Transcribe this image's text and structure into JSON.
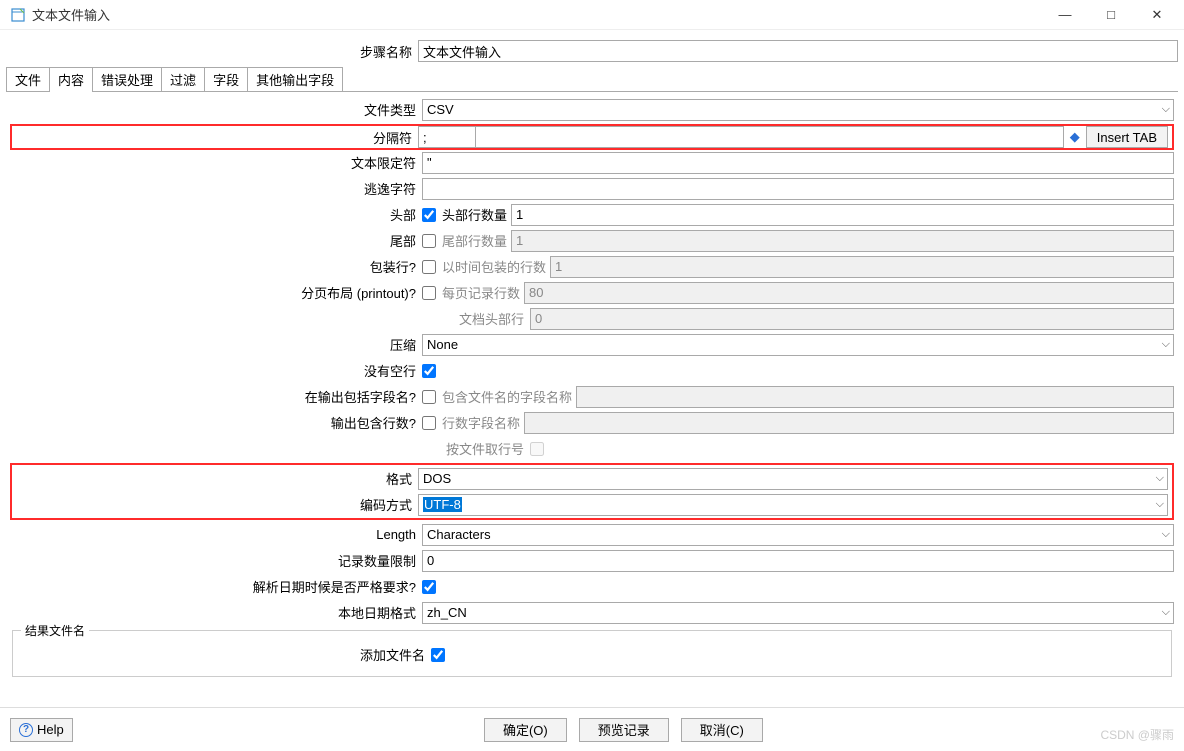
{
  "window": {
    "title": "文本文件输入",
    "min": "—",
    "max": "□",
    "close": "✕"
  },
  "step": {
    "label": "步骤名称",
    "value": "文本文件输入"
  },
  "tabs": [
    "文件",
    "内容",
    "错误处理",
    "过滤",
    "字段",
    "其他输出字段"
  ],
  "labels": {
    "filetype": "文件类型",
    "separator": "分隔符",
    "enclosure": "文本限定符",
    "escape": "逃逸字符",
    "header": "头部",
    "header_rows": "头部行数量",
    "footer": "尾部",
    "footer_rows": "尾部行数量",
    "wrap": "包装行?",
    "wrap_rows": "以时间包装的行数",
    "paged": "分页布局 (printout)?",
    "paged_rows": "每页记录行数",
    "doc_header": "文档头部行",
    "compress": "压缩",
    "no_empty": "没有空行",
    "inc_filename": "在输出包括字段名?",
    "inc_filename_ph": "包含文件名的字段名称",
    "inc_rownum": "输出包含行数?",
    "inc_rownum_ph": "行数字段名称",
    "by_file": "按文件取行号",
    "format": "格式",
    "encoding": "编码方式",
    "length": "Length",
    "limit": "记录数量限制",
    "strict": "解析日期时候是否严格要求?",
    "locale": "本地日期格式",
    "add_filename": "添加文件名"
  },
  "values": {
    "filetype": "CSV",
    "separator": ";",
    "enclosure": "\"",
    "escape": "",
    "header_rows": "1",
    "footer_rows": "1",
    "wrap_rows": "1",
    "paged_rows": "80",
    "doc_header": "0",
    "compress": "None",
    "format": "DOS",
    "encoding": "UTF-8",
    "length": "Characters",
    "limit": "0",
    "locale": "zh_CN"
  },
  "checks": {
    "header": true,
    "footer": false,
    "wrap": false,
    "paged": false,
    "no_empty": true,
    "inc_filename": false,
    "inc_rownum": false,
    "by_file": false,
    "strict": true,
    "add_filename": true
  },
  "buttons": {
    "insert_tab": "Insert TAB",
    "ok": "确定(O)",
    "preview": "预览记录",
    "cancel": "取消(C)",
    "help": "Help"
  },
  "fieldset": {
    "legend": "结果文件名"
  },
  "watermark": "CSDN @骤雨"
}
